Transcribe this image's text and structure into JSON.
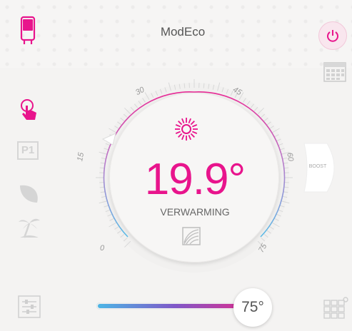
{
  "header": {
    "title": "ModEco",
    "heater_icon": "water-heater-icon",
    "power_icon": "power-icon",
    "calendar_icon": "calendar-icon"
  },
  "sidebar": {
    "items": [
      {
        "name": "manual-touch-icon",
        "active": true
      },
      {
        "name": "p1-program-icon",
        "label": "P1",
        "active": false
      },
      {
        "name": "eco-leaf-icon",
        "active": false
      },
      {
        "name": "holiday-palm-icon",
        "active": false
      }
    ]
  },
  "dial": {
    "temperature": "19.9°",
    "mode_label": "VERWARMING",
    "scale_labels": [
      "0",
      "15",
      "30",
      "45",
      "60",
      "75"
    ],
    "sun_icon": "sun-heating-icon",
    "wave_icon": "heat-wave-icon"
  },
  "boost": {
    "label": "BOOST"
  },
  "setpoint": {
    "value_label": "75°",
    "value": 75,
    "min": 0,
    "max": 75
  },
  "footer": {
    "settings_icon": "settings-sliders-icon",
    "grid_icon": "grid-menu-icon"
  },
  "colors": {
    "accent": "#e8148c",
    "cold": "#4ab7e6",
    "mid": "#7f58c8"
  }
}
